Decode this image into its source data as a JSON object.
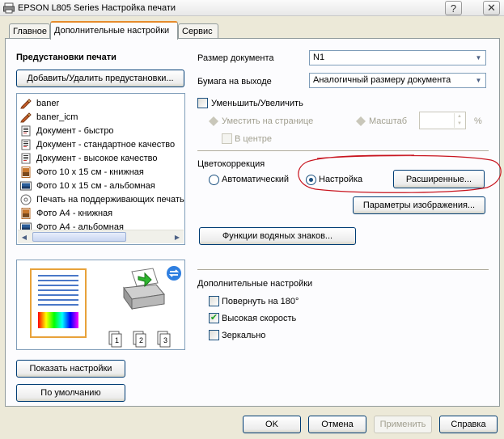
{
  "window": {
    "title": "EPSON L805 Series Настройка печати",
    "help_button": "?",
    "close_button": "✕"
  },
  "tabs": [
    "Главное",
    "Дополнительные настройки",
    "Сервис"
  ],
  "presets": {
    "heading": "Предустановки печати",
    "add_remove_button": "Добавить/Удалить предустановки...",
    "items": [
      {
        "label": "baner",
        "icon": "pencil-icon"
      },
      {
        "label": "baner_icm",
        "icon": "pencil-icon"
      },
      {
        "label": "Документ - быстро",
        "icon": "document-icon"
      },
      {
        "label": "Документ - стандартное качество",
        "icon": "document-icon"
      },
      {
        "label": "Документ - высокое качество",
        "icon": "document-icon"
      },
      {
        "label": "Фото 10 x 15 см - книжная",
        "icon": "photo-portrait-icon"
      },
      {
        "label": "Фото 10 x 15 см - альбомная",
        "icon": "photo-landscape-icon"
      },
      {
        "label": "Печать на поддерживающих печать",
        "icon": "disc-icon"
      },
      {
        "label": "Фото A4 - книжная",
        "icon": "photo-portrait-icon"
      },
      {
        "label": "Фото A4 - альбомная",
        "icon": "photo-landscape-icon"
      }
    ]
  },
  "preview": {
    "page_labels": [
      "1",
      "2",
      "3"
    ]
  },
  "left_buttons": {
    "show_settings": "Показать настройки",
    "defaults": "По умолчанию"
  },
  "document_size": {
    "label": "Размер документа",
    "value": "N1"
  },
  "output_paper": {
    "label": "Бумага на выходе",
    "value": "Аналогичный размеру документа"
  },
  "reduce_enlarge": {
    "label": "Уменьшить/Увеличить",
    "fit_to_page": "Уместить на странице",
    "scale": "Масштаб",
    "scale_unit": "%",
    "center": "В центре"
  },
  "color_correction": {
    "heading": "Цветокоррекция",
    "automatic": "Автоматический",
    "custom": "Настройка",
    "advanced_button": "Расширенные...",
    "image_options_button": "Параметры изображения..."
  },
  "watermark_button": "Функции водяных знаков...",
  "additional": {
    "heading": "Дополнительные настройки",
    "rotate": "Повернуть на 180°",
    "high_speed": "Высокая скорость",
    "mirror": "Зеркально",
    "rotate_checked": false,
    "high_speed_checked": true,
    "mirror_checked": false
  },
  "dialog_buttons": {
    "ok": "OK",
    "cancel": "Отмена",
    "apply": "Применить",
    "help": "Справка"
  },
  "colors": {
    "annotation_ellipse": "#c8141e",
    "window_bg": "#ece9d8",
    "active_tab_accent": "#e68b2c"
  }
}
